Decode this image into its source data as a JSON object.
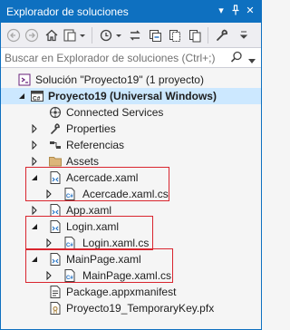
{
  "window": {
    "title": "Explorador de soluciones",
    "controls": [
      "▾",
      "Ѱ",
      "✕"
    ],
    "accent": "#0e70c0",
    "selection": "#cce8ff",
    "highlight_border": "#d9252e"
  },
  "toolbar": {
    "buttons": [
      "back-icon",
      "forward-icon",
      "home-icon",
      "switch-views-icon",
      "pending-changes-icon",
      "sync-icon",
      "collapse-all-icon",
      "show-all-files-icon",
      "properties-wrench-icon"
    ]
  },
  "search": {
    "placeholder": "Buscar en Explorador de soluciones (Ctrl+;)"
  },
  "tree": {
    "solution": "Solución \"Proyecto19\"  (1 proyecto)",
    "project": "Proyecto19 (Universal Windows)",
    "project_badge": "C#",
    "items": [
      {
        "label": "Connected Services",
        "icon": "connected-services-icon"
      },
      {
        "label": "Properties",
        "icon": "properties-icon"
      },
      {
        "label": "Referencias",
        "icon": "references-icon"
      },
      {
        "label": "Assets",
        "icon": "folder-icon"
      },
      {
        "label": "Acercade.xaml",
        "icon": "xaml-file-icon"
      },
      {
        "label": "Acercade.xaml.cs",
        "icon": "cs-file-icon"
      },
      {
        "label": "App.xaml",
        "icon": "xaml-file-icon"
      },
      {
        "label": "Login.xaml",
        "icon": "xaml-file-icon"
      },
      {
        "label": "Login.xaml.cs",
        "icon": "cs-file-icon"
      },
      {
        "label": "MainPage.xaml",
        "icon": "xaml-file-icon"
      },
      {
        "label": "MainPage.xaml.cs",
        "icon": "cs-file-icon"
      },
      {
        "label": "Package.appxmanifest",
        "icon": "manifest-icon"
      },
      {
        "label": "Proyecto19_TemporaryKey.pfx",
        "icon": "certificate-icon"
      }
    ]
  }
}
